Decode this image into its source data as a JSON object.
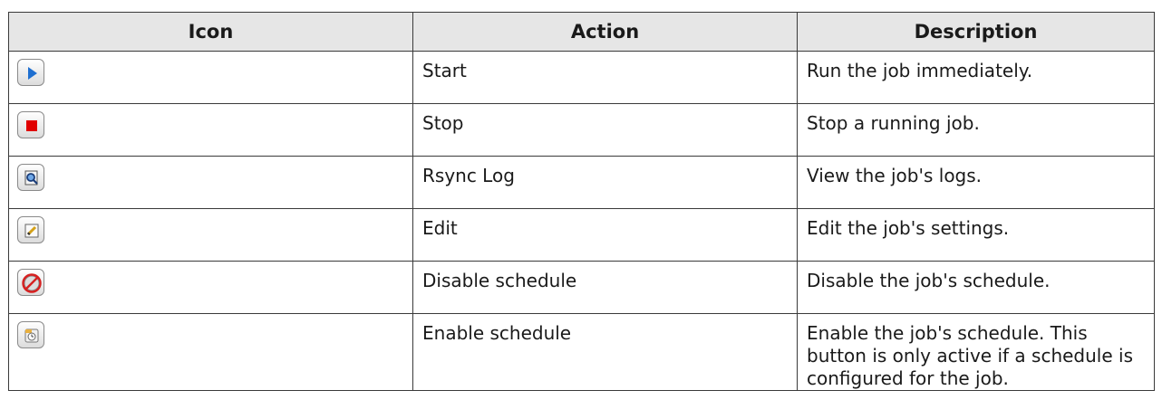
{
  "table": {
    "headers": {
      "icon": "Icon",
      "action": "Action",
      "description": "Description"
    },
    "rows": [
      {
        "icon": "play-icon",
        "action": "Start",
        "description": "Run the job immediately."
      },
      {
        "icon": "stop-icon",
        "action": "Stop",
        "description": "Stop a running job."
      },
      {
        "icon": "magnifier-log-icon",
        "action": "Rsync Log",
        "description": "View the job's logs."
      },
      {
        "icon": "edit-pencil-icon",
        "action": "Edit",
        "description": "Edit the job's settings."
      },
      {
        "icon": "disable-schedule-icon",
        "action": "Disable schedule",
        "description": "Disable the job's schedule."
      },
      {
        "icon": "enable-schedule-icon",
        "action": "Enable schedule",
        "description": "Enable the job's schedule. This button is only active if a schedule is configured for the job."
      }
    ]
  },
  "colors": {
    "header_bg": "#e6e6e6",
    "border": "#3a3a3a",
    "play_blue": "#1e6fd0",
    "stop_red": "#e00000",
    "disable_red": "#d62020"
  }
}
